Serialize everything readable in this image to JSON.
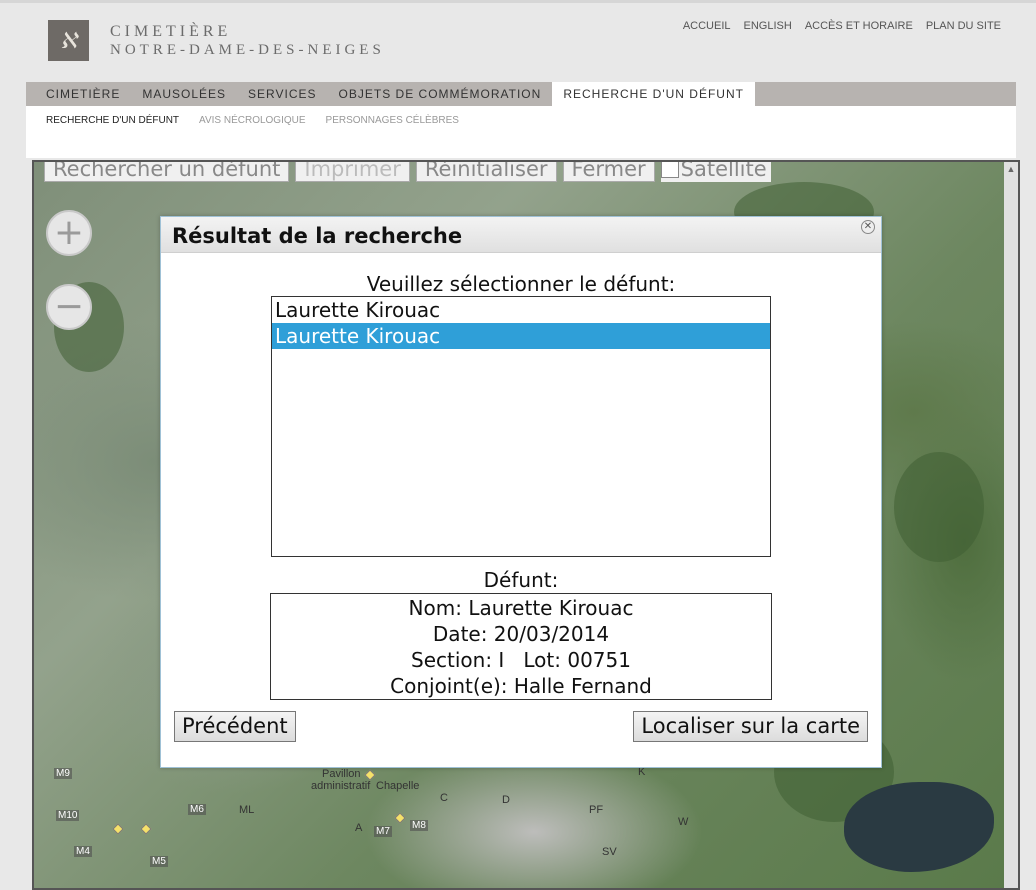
{
  "header": {
    "logo_glyph": "ℵ",
    "site_name_line1": "Cimetière",
    "site_name_line2": "Notre-Dame-des-Neiges",
    "top_links": [
      "ACCUEIL",
      "ENGLISH",
      "ACCÈS ET HORAIRE",
      "PLAN DU SITE"
    ]
  },
  "nav": {
    "main": [
      "CIMETIÈRE",
      "MAUSOLÉES",
      "SERVICES",
      "OBJETS DE COMMÉMORATION",
      "RECHERCHE D'UN DÉFUNT"
    ],
    "sub": [
      "RECHERCHE D'UN DÉFUNT",
      "AVIS NÉCROLOGIQUE",
      "PERSONNAGES CÉLÈBRES"
    ]
  },
  "map": {
    "toolbar": {
      "search": "Rechercher un défunt",
      "print": "Imprimer",
      "reset": "Réinitialiser",
      "close": "Fermer",
      "satellite": "Satellite"
    },
    "zoom_in": "+",
    "zoom_out": "−",
    "labels": {
      "pavillon": "Pavillon",
      "administratif": "administratif",
      "chapelle": "Chapelle",
      "C": "C",
      "D": "D",
      "K": "K",
      "PF": "PF",
      "W": "W",
      "SV": "SV",
      "A": "A",
      "ML": "ML",
      "M9": "M9",
      "M10": "M10",
      "M4": "M4",
      "M5": "M5",
      "M6": "M6",
      "M7": "M7",
      "M8": "M8"
    }
  },
  "modal": {
    "title": "Résultat de la recherche",
    "prompt": "Veuillez sélectionner le défunt:",
    "options": [
      "Laurette Kirouac",
      "Laurette Kirouac"
    ],
    "selected_index": 1,
    "defunt_label": "Défunt:",
    "info": {
      "nom": "Nom: Laurette Kirouac",
      "date": "Date: 20/03/2014",
      "section_lot": "Section: I   Lot: 00751",
      "conjoint": "Conjoint(e): Halle Fernand"
    },
    "prev_button": "Précédent",
    "locate_button": "Localiser sur la carte"
  },
  "colors": {
    "selected": "#2f9fd8",
    "nav_bg": "#b7b3b0"
  }
}
